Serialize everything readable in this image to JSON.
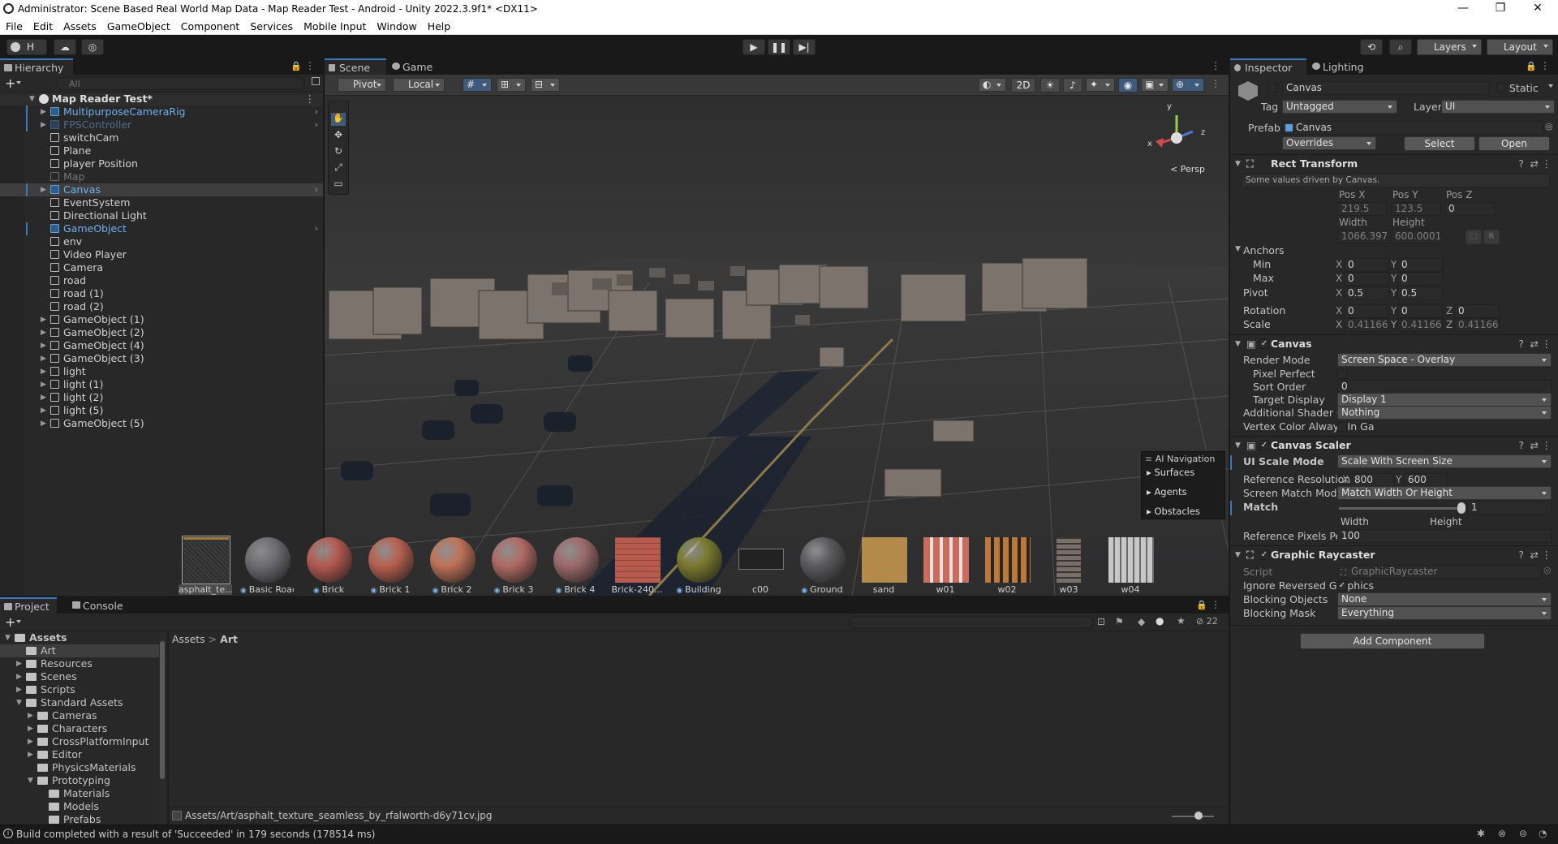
{
  "window": {
    "title": "Administrator: Scene Based Real World Map Data - Map Reader Test - Android - Unity 2022.3.9f1* <DX11>",
    "minimize": "—",
    "maximize": "❐",
    "close": "✕"
  },
  "menu": [
    "File",
    "Edit",
    "Assets",
    "GameObject",
    "Component",
    "Services",
    "Mobile Input",
    "Window",
    "Help"
  ],
  "toolbar": {
    "account": "H",
    "layers": "Layers",
    "layout": "Layout"
  },
  "hierarchy": {
    "tab": "Hierarchy",
    "search_placeholder": "All",
    "scene": "Map Reader Test*",
    "items": [
      {
        "label": "MultipurposeCameraRig",
        "prefab": true,
        "fold": true,
        "arrow": true
      },
      {
        "label": "FPSController",
        "prefab": true,
        "fold": true,
        "arrow": true,
        "disabled": true
      },
      {
        "label": "switchCam"
      },
      {
        "label": "Plane"
      },
      {
        "label": "player Position"
      },
      {
        "label": "Map",
        "disabled": true
      },
      {
        "label": "Canvas",
        "prefab": true,
        "fold": true,
        "arrow": true,
        "selected": true
      },
      {
        "label": "EventSystem"
      },
      {
        "label": "Directional Light"
      },
      {
        "label": "GameObject",
        "prefab": true,
        "arrow": true
      },
      {
        "label": "env"
      },
      {
        "label": "Video Player"
      },
      {
        "label": "Camera"
      },
      {
        "label": "road"
      },
      {
        "label": "road (1)"
      },
      {
        "label": "road (2)"
      },
      {
        "label": "GameObject (1)",
        "fold": true
      },
      {
        "label": "GameObject (2)",
        "fold": true
      },
      {
        "label": "GameObject (4)",
        "fold": true
      },
      {
        "label": "GameObject (3)",
        "fold": true
      },
      {
        "label": "light",
        "fold": true
      },
      {
        "label": "light (1)",
        "fold": true
      },
      {
        "label": "light (2)",
        "fold": true
      },
      {
        "label": "light (5)",
        "fold": true
      },
      {
        "label": "GameObject (5)",
        "fold": true
      }
    ]
  },
  "scene": {
    "tab_scene": "Scene",
    "tab_game": "Game",
    "pivot": "Pivot",
    "local": "Local",
    "mode2d": "2D",
    "persp": "< Persp",
    "gizmo_x": "x",
    "gizmo_y": "y",
    "gizmo_z": "z",
    "ai_nav": {
      "title": "AI Navigation",
      "items": [
        "Surfaces",
        "Agents",
        "Obstacles"
      ]
    }
  },
  "inspector": {
    "tab": "Inspector",
    "tab2": "Lighting",
    "name": "Canvas",
    "static": "Static",
    "tag_label": "Tag",
    "tag": "Untagged",
    "layer_label": "Layer",
    "layer": "UI",
    "prefab_label": "Prefab",
    "prefab": "Canvas",
    "overrides": "Overrides",
    "select": "Select",
    "open": "Open",
    "rect": {
      "title": "Rect Transform",
      "note": "Some values driven by Canvas.",
      "posx_l": "Pos X",
      "posy_l": "Pos Y",
      "posz_l": "Pos Z",
      "posx": "219.5",
      "posy": "123.5",
      "posz": "0",
      "width_l": "Width",
      "height_l": "Height",
      "width": "1066.397",
      "height": "600.0001",
      "r": "R",
      "anchors": "Anchors",
      "min": "Min",
      "max": "Max",
      "pivot": "Pivot",
      "rotation": "Rotation",
      "scale": "Scale",
      "min_x": "0",
      "min_y": "0",
      "max_x": "0",
      "max_y": "0",
      "pivot_x": "0.5",
      "pivot_y": "0.5",
      "rot_x": "0",
      "rot_y": "0",
      "rot_z": "0",
      "scale_x": "0.4116666",
      "scale_y": "0.4116666",
      "scale_z": "0.4116666",
      "lx": "X",
      "ly": "Y",
      "lz": "Z"
    },
    "canvas": {
      "title": "Canvas",
      "render_mode_l": "Render Mode",
      "render_mode": "Screen Space - Overlay",
      "pixel_perfect_l": "Pixel Perfect",
      "sort_order_l": "Sort Order",
      "sort_order": "0",
      "target_display_l": "Target Display",
      "target_display": "Display 1",
      "shader_l": "Additional Shader Channe",
      "shader": "Nothing",
      "vertex_l": "Vertex Color Always In Ga"
    },
    "scaler": {
      "title": "Canvas Scaler",
      "ui_scale_l": "UI Scale Mode",
      "ui_scale": "Scale With Screen Size",
      "ref_res_l": "Reference Resolution",
      "ref_x": "800",
      "ref_y": "600",
      "match_mode_l": "Screen Match Mode",
      "match_mode": "Match Width Or Height",
      "match_l": "Match",
      "match": "1",
      "match_value": 1,
      "width": "Width",
      "height": "Height",
      "ppu_l": "Reference Pixels Per Unit",
      "ppu": "100"
    },
    "raycaster": {
      "title": "Graphic Raycaster",
      "script_l": "Script",
      "script": "GraphicRaycaster",
      "ignore_l": "Ignore Reversed Graphics",
      "blocking_obj_l": "Blocking Objects",
      "blocking_obj": "None",
      "blocking_mask_l": "Blocking Mask",
      "blocking_mask": "Everything"
    },
    "add_component": "Add Component"
  },
  "project": {
    "tab": "Project",
    "tab2": "Console",
    "breadcrumb_root": "Assets",
    "breadcrumb_sep": ">",
    "breadcrumb_cur": "Art",
    "count": "22",
    "tree": [
      {
        "label": "Assets",
        "bold": true,
        "depth": 0,
        "open": true
      },
      {
        "label": "Art",
        "depth": 1,
        "selected": true
      },
      {
        "label": "Resources",
        "depth": 1,
        "fold": true
      },
      {
        "label": "Scenes",
        "depth": 1,
        "fold": true
      },
      {
        "label": "Scripts",
        "depth": 1,
        "fold": true
      },
      {
        "label": "Standard Assets",
        "depth": 1,
        "open": true
      },
      {
        "label": "Cameras",
        "depth": 2,
        "fold": true
      },
      {
        "label": "Characters",
        "depth": 2,
        "fold": true
      },
      {
        "label": "CrossPlatformInput",
        "depth": 2,
        "fold": true
      },
      {
        "label": "Editor",
        "depth": 2,
        "fold": true
      },
      {
        "label": "PhysicsMaterials",
        "depth": 2
      },
      {
        "label": "Prototyping",
        "depth": 2,
        "open": true
      },
      {
        "label": "Materials",
        "depth": 3
      },
      {
        "label": "Models",
        "depth": 3
      },
      {
        "label": "Prefabs",
        "depth": 3
      }
    ],
    "assets": [
      {
        "label": "asphalt_te...",
        "kind": "asphalt",
        "selected": true
      },
      {
        "label": "Basic Road",
        "kind": "sphere",
        "color": "#6d6d72",
        "mat": true
      },
      {
        "label": "Brick",
        "kind": "sphere",
        "color": "#b45a50",
        "mat": true
      },
      {
        "label": "Brick 1",
        "kind": "sphere",
        "color": "#b8614f",
        "mat": true
      },
      {
        "label": "Brick 2",
        "kind": "sphere",
        "color": "#c07257",
        "mat": true
      },
      {
        "label": "Brick 3",
        "kind": "sphere",
        "color": "#b06a63",
        "mat": true
      },
      {
        "label": "Brick 4",
        "kind": "sphere",
        "color": "#9c6a6a",
        "mat": true
      },
      {
        "label": "Brick-240...",
        "kind": "brick"
      },
      {
        "label": "Building",
        "kind": "sphere",
        "color": "#7a7a2e",
        "mat": true
      },
      {
        "label": "c00",
        "kind": "c00"
      },
      {
        "label": "Ground",
        "kind": "sphere",
        "color": "#5b5b5e",
        "mat": true
      },
      {
        "label": "sand",
        "kind": "sand"
      },
      {
        "label": "w01",
        "kind": "w01"
      },
      {
        "label": "w02",
        "kind": "w02"
      },
      {
        "label": "w03",
        "kind": "w03"
      },
      {
        "label": "w04",
        "kind": "w04"
      }
    ],
    "path": "Assets/Art/asphalt_texture_seamless_by_rfalworth-d6y71cv.jpg"
  },
  "status": "Build completed with a result of 'Succeeded' in 179 seconds (178514 ms)"
}
